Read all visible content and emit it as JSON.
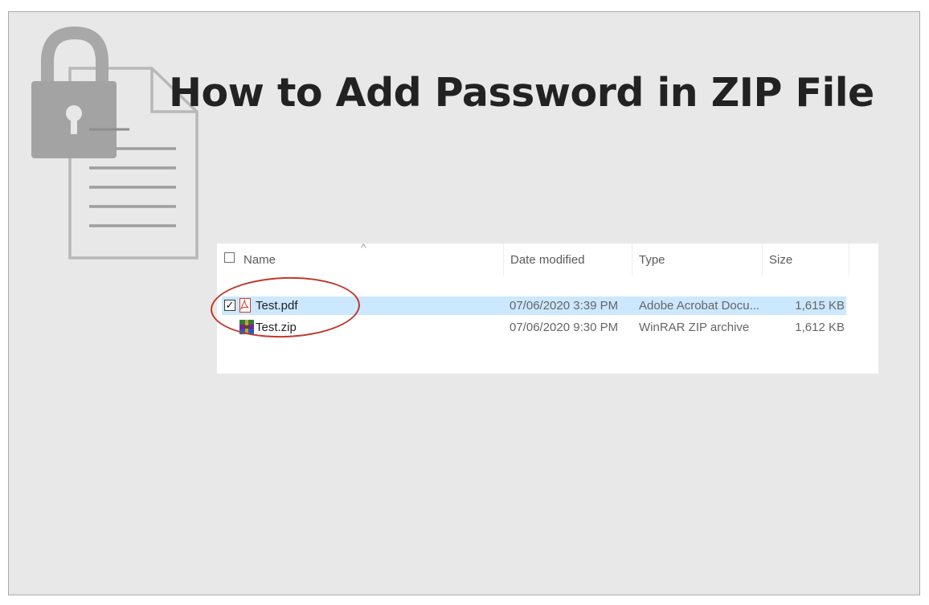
{
  "slide": {
    "title": "How to Add Password in ZIP File"
  },
  "explorer": {
    "columns": {
      "name": "Name",
      "date_modified": "Date modified",
      "type": "Type",
      "size": "Size"
    },
    "sort_indicator": "^",
    "files": [
      {
        "name": "Test.pdf",
        "date_modified": "07/06/2020 3:39 PM",
        "type": "Adobe Acrobat Docu...",
        "size": "1,615 KB",
        "selected": true,
        "icon": "pdf-file-icon"
      },
      {
        "name": "Test.zip",
        "date_modified": "07/06/2020 9:30 PM",
        "type": "WinRAR ZIP archive",
        "size": "1,612 KB",
        "selected": false,
        "icon": "winrar-archive-icon"
      }
    ],
    "check_mark": "✓"
  },
  "colors": {
    "slide_background": "#e8e8e8",
    "selection": "#cce8ff",
    "highlight_ring": "#c0392b",
    "graphic_gray": "#9e9e9e"
  }
}
